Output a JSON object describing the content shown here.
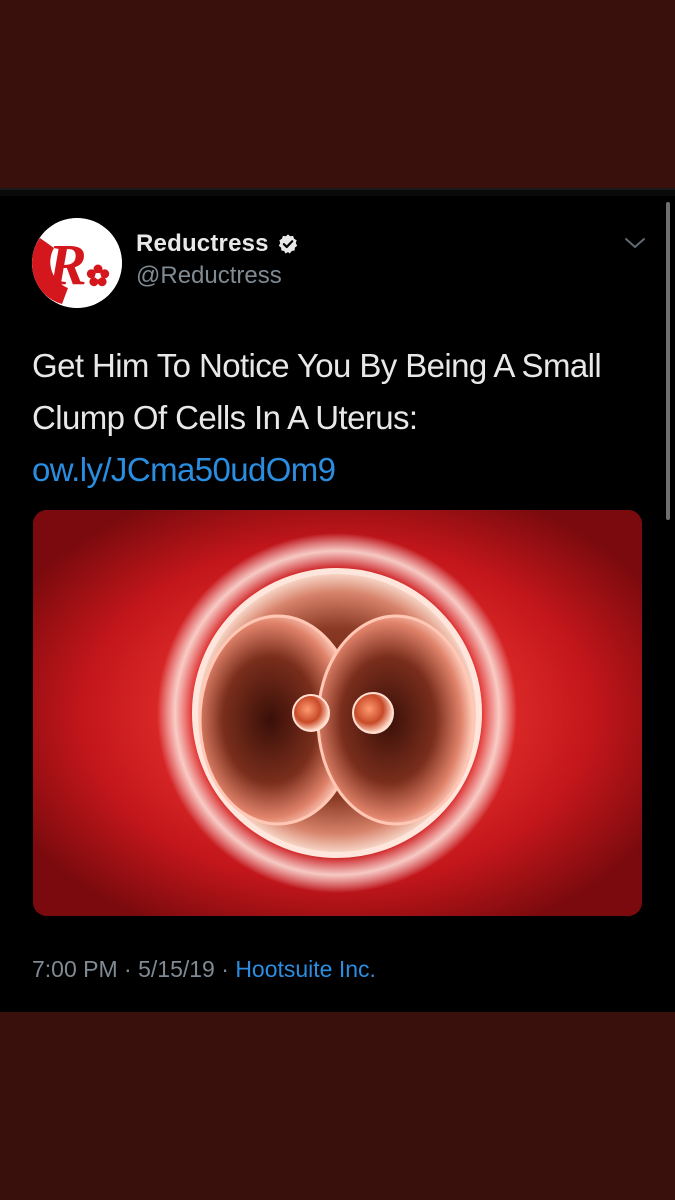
{
  "tweet": {
    "display_name": "Reductress",
    "handle": "@Reductress",
    "text": "Get Him To Notice You By Being A Small Clump Of Cells In A Uterus: ",
    "link": "ow.ly/JCma50udOm9",
    "time": "7:00 PM",
    "separator": " · ",
    "date": "5/15/19",
    "source": "Hootsuite Inc."
  },
  "avatar": {
    "logo_letter": "R"
  },
  "icons": {
    "verified": "verified-badge-icon",
    "more": "chevron-down-icon"
  },
  "colors": {
    "page_background": "#3a100d",
    "card_background": "#000000",
    "link": "#2a8de0",
    "secondary_text": "#7f8a93",
    "brand_red": "#d4161d"
  }
}
